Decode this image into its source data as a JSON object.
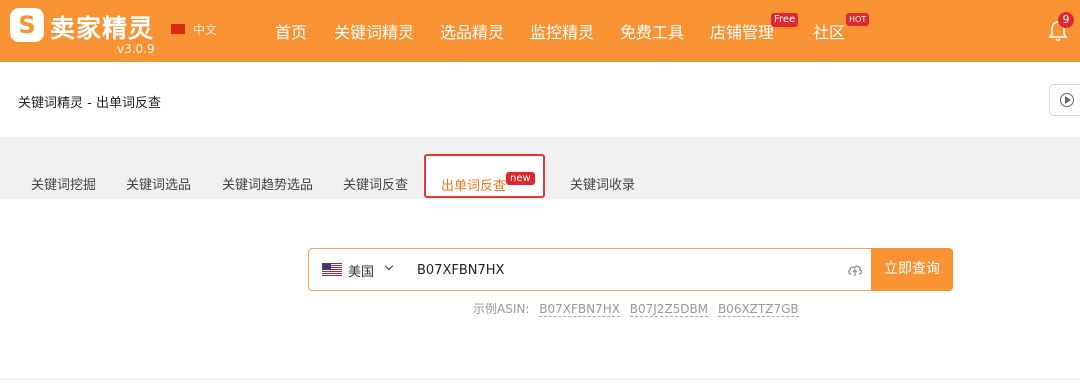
{
  "header": {
    "brand": "卖家精灵",
    "logo_glyph": "S",
    "version": "v3.0.9",
    "language": "中文",
    "nav": [
      {
        "label": "首页"
      },
      {
        "label": "关键词精灵"
      },
      {
        "label": "选品精灵"
      },
      {
        "label": "监控精灵"
      },
      {
        "label": "免费工具"
      },
      {
        "label": "店铺管理",
        "badge": "Free"
      },
      {
        "label": "社区",
        "badge": "HOT"
      }
    ],
    "notifications": "9",
    "colors": {
      "brand": "#F89232",
      "badge": "#E0262E"
    }
  },
  "breadcrumb": "关键词精灵 - 出单词反查",
  "tabs": [
    {
      "label": "关键词挖掘"
    },
    {
      "label": "关键词选品"
    },
    {
      "label": "关键词趋势选品"
    },
    {
      "label": "关键词反查"
    },
    {
      "label": "出单词反查",
      "badge": "new",
      "active": true
    },
    {
      "label": "关键词收录"
    }
  ],
  "search": {
    "country": "美国",
    "value": "B07XFBN7HX",
    "button": "立即查询",
    "examples_label": "示例ASIN:",
    "examples": [
      "B07XFBN7HX",
      "B07J2Z5DBM",
      "B06XZTZ7GB"
    ]
  }
}
